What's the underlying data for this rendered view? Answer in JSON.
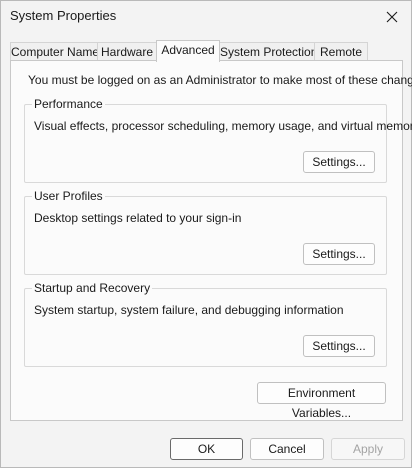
{
  "window": {
    "title": "System Properties"
  },
  "tabs": [
    {
      "label": "Computer Name",
      "active": false
    },
    {
      "label": "Hardware",
      "active": false
    },
    {
      "label": "Advanced",
      "active": true
    },
    {
      "label": "System Protection",
      "active": false
    },
    {
      "label": "Remote",
      "active": false
    }
  ],
  "advanced": {
    "notice": "You must be logged on as an Administrator to make most of these changes.",
    "performance": {
      "label": "Performance",
      "description": "Visual effects, processor scheduling, memory usage, and virtual memory",
      "button": "Settings..."
    },
    "user_profiles": {
      "label": "User Profiles",
      "description": "Desktop settings related to your sign-in",
      "button": "Settings..."
    },
    "startup_recovery": {
      "label": "Startup and Recovery",
      "description": "System startup, system failure, and debugging information",
      "button": "Settings..."
    },
    "env_button": "Environment Variables..."
  },
  "footer": {
    "ok": "OK",
    "cancel": "Cancel",
    "apply": "Apply"
  },
  "icons": {
    "close": "close-icon"
  },
  "colors": {
    "window_bg": "#f3f3f3",
    "panel_bg": "#fbfbfb",
    "disabled_text": "#a4a4a4"
  }
}
